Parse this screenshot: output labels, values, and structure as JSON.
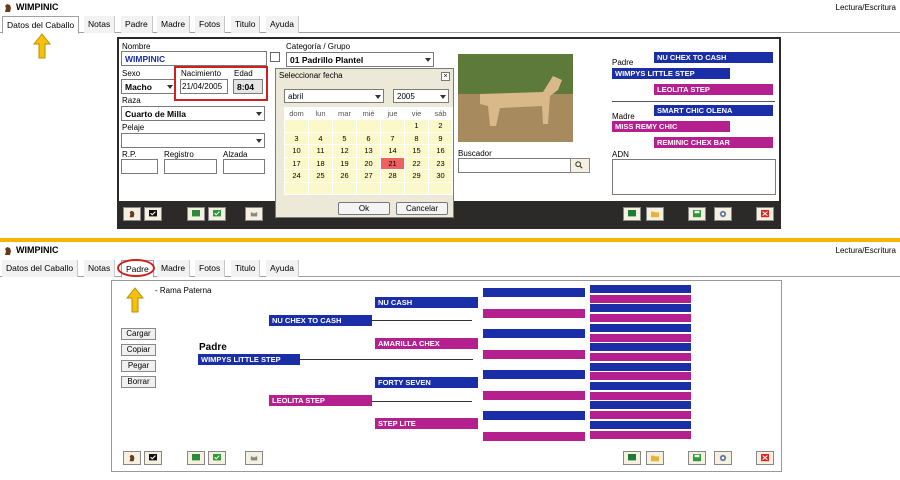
{
  "app": {
    "title": "WIMPINIC",
    "mode": "Lectura/Escritura"
  },
  "tabs": [
    "Datos del Caballo",
    "Notas",
    "Padre",
    "Madre",
    "Fotos",
    "Titulo",
    "Ayuda"
  ],
  "horse_form": {
    "nombre_label": "Nombre",
    "nombre_value": "WIMPINIC",
    "sexo_label": "Sexo",
    "sexo_value": "Macho",
    "nacimiento_label": "Nacimiento",
    "nacimiento_value": "21/04/2005",
    "edad_label": "Edad",
    "edad_value": "8:04",
    "raza_label": "Raza",
    "raza_value": "Cuarto de Milla",
    "pelaje_label": "Pelaje",
    "pelaje_value": "",
    "rp_label": "R.P.",
    "registro_label": "Registro",
    "alzada_label": "Alzada",
    "categoria_label": "Categoría / Grupo",
    "categoria_value": "01 Padrillo Plantel",
    "buscador_label": "Buscador",
    "adn_label": "ADN"
  },
  "pedigree_summary": {
    "padre_label": "Padre",
    "padre": "WIMPYS LITTLE STEP",
    "paternal_grandsire": "NU CHEX TO CASH",
    "paternal_granddam": "LEOLITA STEP",
    "madre_label": "Madre",
    "madre": "MISS REMY CHIC",
    "maternal_grandsire": "SMART CHIC OLENA",
    "maternal_granddam": "REMINIC CHEX BAR"
  },
  "calendar": {
    "title": "Seleccionar fecha",
    "month": "abril",
    "year": "2005",
    "days_header": [
      "dom",
      "lun",
      "mar",
      "mié",
      "jue",
      "vie",
      "sáb"
    ],
    "weeks": [
      [
        "",
        "",
        "",
        "",
        "",
        "1",
        "2"
      ],
      [
        "3",
        "4",
        "5",
        "6",
        "7",
        "8",
        "9"
      ],
      [
        "10",
        "11",
        "12",
        "13",
        "14",
        "15",
        "16"
      ],
      [
        "17",
        "18",
        "19",
        "20",
        "21",
        "22",
        "23"
      ],
      [
        "24",
        "25",
        "26",
        "27",
        "28",
        "29",
        "30"
      ],
      [
        "",
        "",
        "",
        "",
        "",
        "",
        ""
      ]
    ],
    "selected_day": "21",
    "ok_label": "Ok",
    "cancel_label": "Cancelar"
  },
  "pedigree_tab": {
    "rama_label": "- Rama Paterna",
    "padre_heading": "Padre",
    "sire": "WIMPYS LITTLE STEP",
    "gen2": [
      "NU CHEX TO CASH",
      "LEOLITA STEP"
    ],
    "gen3": [
      "NU CASH",
      "AMARILLA CHEX",
      "FORTY SEVEN",
      "STEP LITE"
    ],
    "buttons": [
      "Cargar",
      "Copiar",
      "Pegar",
      "Borrar"
    ]
  },
  "colors": {
    "navy": "#1a2ea8",
    "magenta": "#b5208f",
    "accent_yellow": "#f2b705",
    "panel_dark": "#2b2a28",
    "highlight_red": "#e03030"
  }
}
